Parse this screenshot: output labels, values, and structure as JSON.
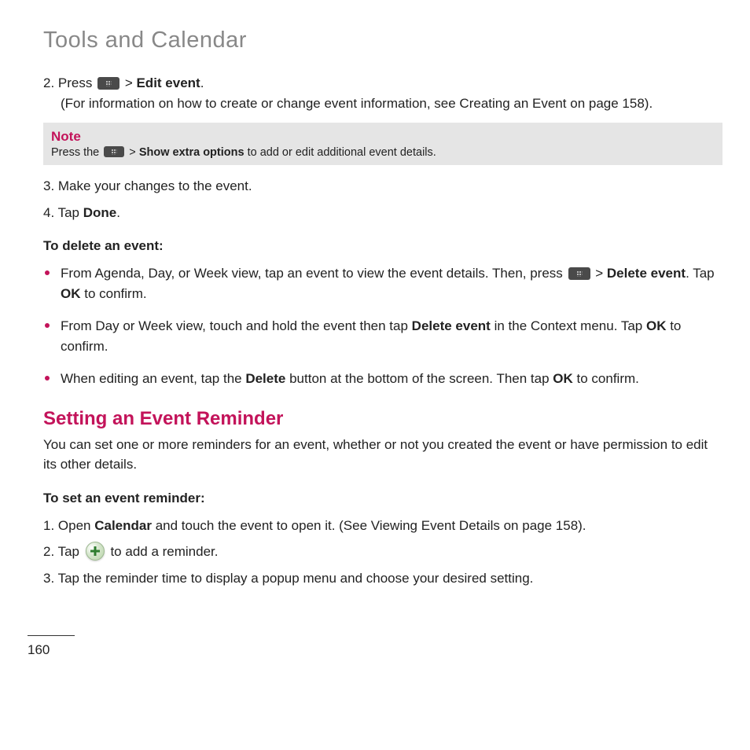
{
  "chapter_title": "Tools and Calendar",
  "step2_prefix": "2. Press  ",
  "step2_after_icon": "  > ",
  "step2_bold": "Edit event",
  "step2_suffix": ".",
  "step2_line2": "(For information on how to create or change event information, see Creating an Event on page 158).",
  "note_label": "Note",
  "note_prefix": "Press the  ",
  "note_after_icon": " > ",
  "note_bold": "Show extra options",
  "note_suffix": " to add or edit additional event details.",
  "step3": "3. Make your changes to the event.",
  "step4_prefix": "4. Tap ",
  "step4_bold": "Done",
  "step4_suffix": ".",
  "delete_heading": "To delete an event:",
  "bullet1_prefix": "From Agenda, Day, or Week view, tap an event to view the event details. Then, press  ",
  "bullet1_after_icon": "  > ",
  "bullet1_bold1": "Delete event",
  "bullet1_mid": ". Tap ",
  "bullet1_bold2": "OK",
  "bullet1_suffix": " to confirm.",
  "bullet2_prefix": "From Day or Week view, touch and hold the event then tap ",
  "bullet2_bold1": "Delete event",
  "bullet2_mid": " in the Context menu. Tap ",
  "bullet2_bold2": "OK",
  "bullet2_suffix": " to confirm.",
  "bullet3_prefix": "When editing an event, tap the ",
  "bullet3_bold1": "Delete",
  "bullet3_mid": " button at the bottom of the screen. Then tap ",
  "bullet3_bold2": "OK",
  "bullet3_suffix": " to confirm.",
  "section_heading": "Setting an Event Reminder",
  "intro_text": "You can set one or more reminders for an event, whether or not you created the event or have permission to edit its other details.",
  "reminder_heading": "To set an event reminder:",
  "r_step1_prefix": "1. Open ",
  "r_step1_bold": "Calendar",
  "r_step1_suffix": " and touch the event to open it. (See Viewing Event Details on page 158).",
  "r_step2_prefix": "2. Tap  ",
  "r_step2_suffix": "  to add a reminder.",
  "r_step3": "3. Tap the reminder time to display a popup menu and choose your desired setting.",
  "page_number": "160"
}
